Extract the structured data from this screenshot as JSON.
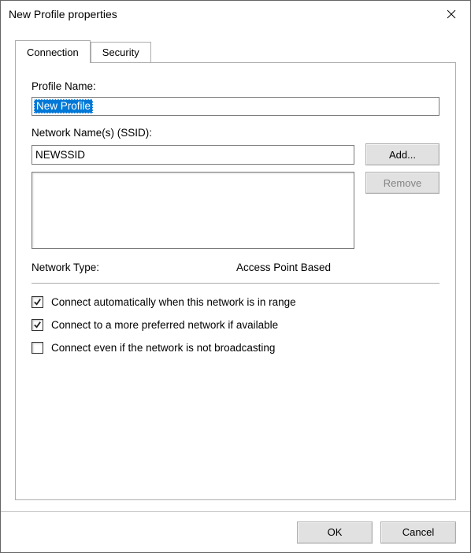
{
  "window": {
    "title": "New Profile properties"
  },
  "tabs": {
    "connection": "Connection",
    "security": "Security"
  },
  "profile": {
    "name_label": "Profile Name:",
    "name_value": "New Profile"
  },
  "ssid": {
    "label": "Network Name(s) (SSID):",
    "input_value": "NEWSSID",
    "add_label": "Add...",
    "remove_label": "Remove"
  },
  "network_type": {
    "label": "Network Type:",
    "value": "Access Point Based"
  },
  "options": {
    "auto_connect": "Connect automatically when this network is in range",
    "prefer_other": "Connect to a more preferred network if available",
    "hidden_ssid": "Connect even if the network is not broadcasting"
  },
  "footer": {
    "ok": "OK",
    "cancel": "Cancel"
  }
}
